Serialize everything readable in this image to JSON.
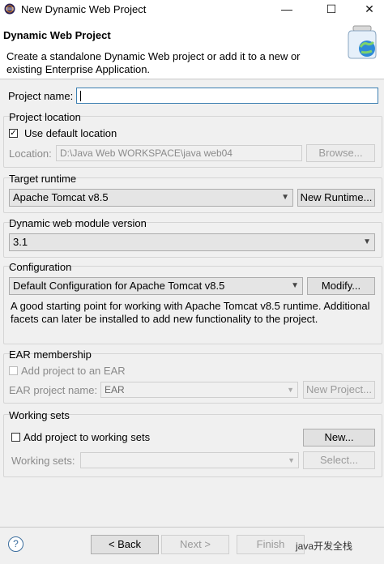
{
  "window": {
    "title": "New Dynamic Web Project",
    "minimize": "—",
    "maximize": "☐",
    "close": "✕"
  },
  "header": {
    "title": "Dynamic Web Project",
    "description": "Create a standalone Dynamic Web project or add it to a new or existing Enterprise Application."
  },
  "project_name": {
    "label": "Project name:",
    "value": ""
  },
  "project_location": {
    "group_label": "Project location",
    "use_default_label": "Use default location",
    "use_default_checked": true,
    "location_label": "Location:",
    "location_value": "D:\\Java Web WORKSPACE\\java web04",
    "browse_label": "Browse..."
  },
  "target_runtime": {
    "group_label": "Target runtime",
    "selected": "Apache Tomcat v8.5",
    "new_runtime_label": "New Runtime..."
  },
  "module_version": {
    "group_label": "Dynamic web module version",
    "selected": "3.1"
  },
  "configuration": {
    "group_label": "Configuration",
    "selected": "Default Configuration for Apache Tomcat v8.5",
    "modify_label": "Modify...",
    "note": "A good starting point for working with Apache Tomcat v8.5 runtime. Additional facets can later be installed to add new functionality to the project."
  },
  "ear": {
    "group_label": "EAR membership",
    "add_label": "Add project to an EAR",
    "project_name_label": "EAR project name:",
    "project_name_value": "EAR",
    "new_project_label": "New Project..."
  },
  "working_sets": {
    "group_label": "Working sets",
    "add_label": "Add project to working sets",
    "new_label": "New...",
    "sets_label": "Working sets:",
    "select_label": "Select..."
  },
  "footer": {
    "help": "?",
    "back_label": "< Back",
    "next_label": "Next >",
    "finish_label": "Finish",
    "watermark": "java开发全栈"
  },
  "colors": {
    "focus_border": "#3c7fb1",
    "panel_bg": "#f0f0f0"
  }
}
